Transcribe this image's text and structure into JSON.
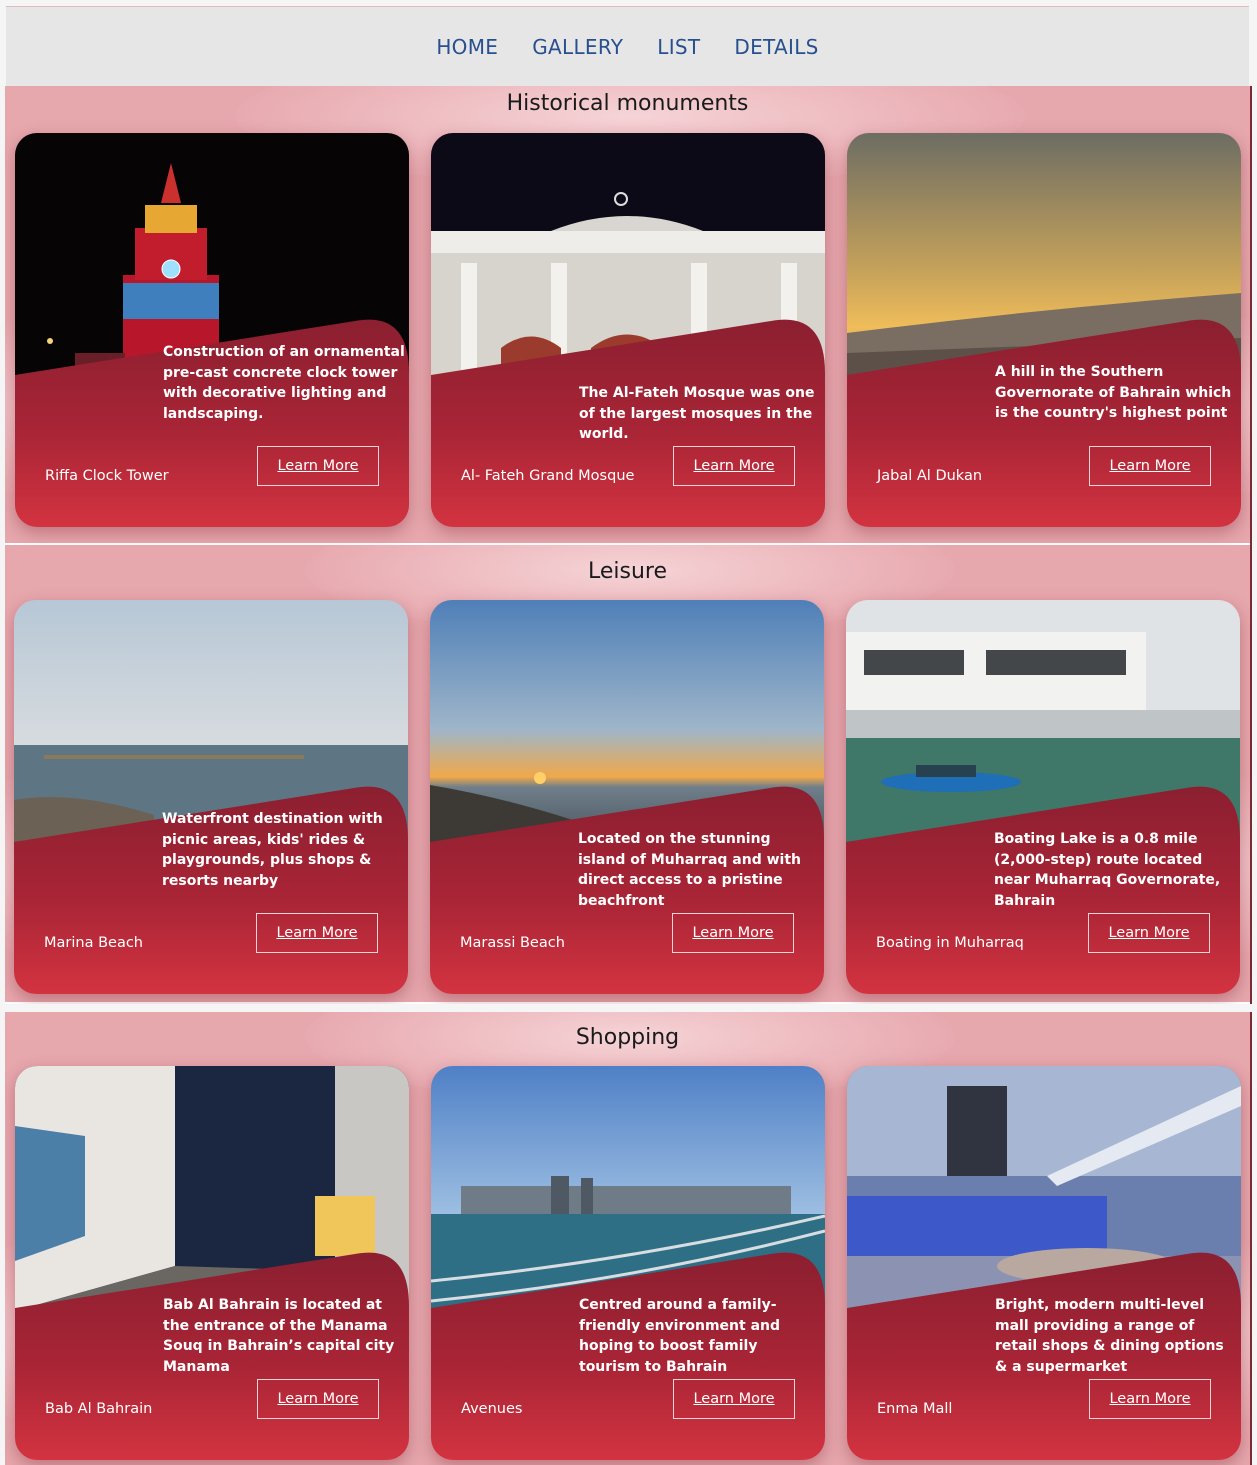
{
  "nav": {
    "items": [
      {
        "label": "HOME"
      },
      {
        "label": "GALLERY"
      },
      {
        "label": "LIST"
      },
      {
        "label": "DETAILS"
      }
    ]
  },
  "colors": {
    "accent": "#c7323e",
    "panel_dark": "#8e2132",
    "section_bg": "#e6a7ad",
    "nav_text": "#284f8f"
  },
  "sections": [
    {
      "title": "Historical monuments",
      "cards": [
        {
          "name": "Riffa Clock Tower",
          "description": "Construction of an ornamental pre-cast concrete clock tower with decorative lighting and landscaping.",
          "button": "Learn More"
        },
        {
          "name": "Al- Fateh Grand Mosque",
          "description": "The Al-Fateh Mosque was one of the largest mosques in the world.",
          "button": "Learn More"
        },
        {
          "name": "Jabal Al Dukan",
          "description": "A hill in the Southern Governorate of Bahrain which is the country's highest point",
          "button": "Learn More"
        }
      ]
    },
    {
      "title": "Leisure",
      "cards": [
        {
          "name": "Marina Beach",
          "description": "Waterfront destination with picnic areas, kids' rides & playgrounds, plus shops & resorts nearby",
          "button": "Learn More"
        },
        {
          "name": "Marassi Beach",
          "description": "Located on the stunning island of Muharraq and with direct access to a pristine beachfront",
          "button": "Learn More"
        },
        {
          "name": "Boating in Muharraq",
          "description": "Boating Lake is a 0.8 mile (2,000-step) route located near Muharraq Governorate, Bahrain",
          "button": "Learn More"
        }
      ]
    },
    {
      "title": "Shopping",
      "cards": [
        {
          "name": "Bab Al Bahrain",
          "description": "Bab Al Bahrain is located at the entrance of the Manama Souq in Bahrain’s capital city Manama",
          "button": "Learn More"
        },
        {
          "name": "Avenues",
          "description": "Centred around a family-friendly environment and hoping to boost family tourism to Bahrain",
          "button": "Learn More"
        },
        {
          "name": "Enma Mall",
          "description": "Bright, modern multi-level mall providing a range of retail shops & dining options & a supermarket",
          "button": "Learn More"
        }
      ]
    }
  ]
}
